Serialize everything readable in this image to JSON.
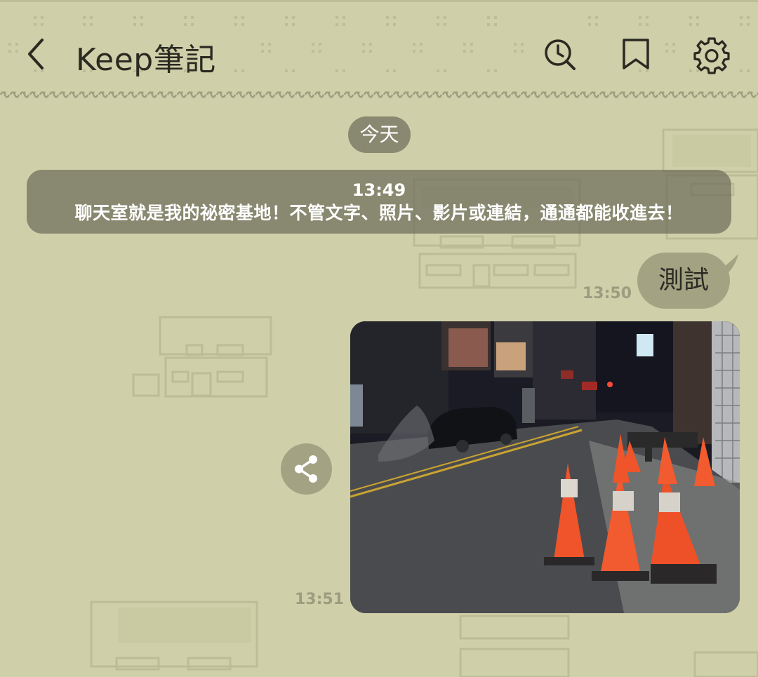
{
  "header": {
    "title": "Keep筆記",
    "icons": [
      "chevron-left-icon",
      "history-search-icon",
      "bookmark-icon",
      "gear-icon"
    ]
  },
  "chat": {
    "date_label": "今天",
    "system_message": {
      "time": "13:49",
      "text": "聊天室就是我的祕密基地！不管文字、照片、影片或連結，通通都能收進去！"
    },
    "messages": [
      {
        "type": "text",
        "text": "測試",
        "time": "13:50"
      },
      {
        "type": "image",
        "time": "13:51",
        "alt_icon": "share-icon"
      }
    ]
  },
  "colors": {
    "background": "#cfcfa9",
    "pill": "#6e6e5c",
    "bubble": "#a3a383",
    "timestamp": "#9c9c80"
  }
}
